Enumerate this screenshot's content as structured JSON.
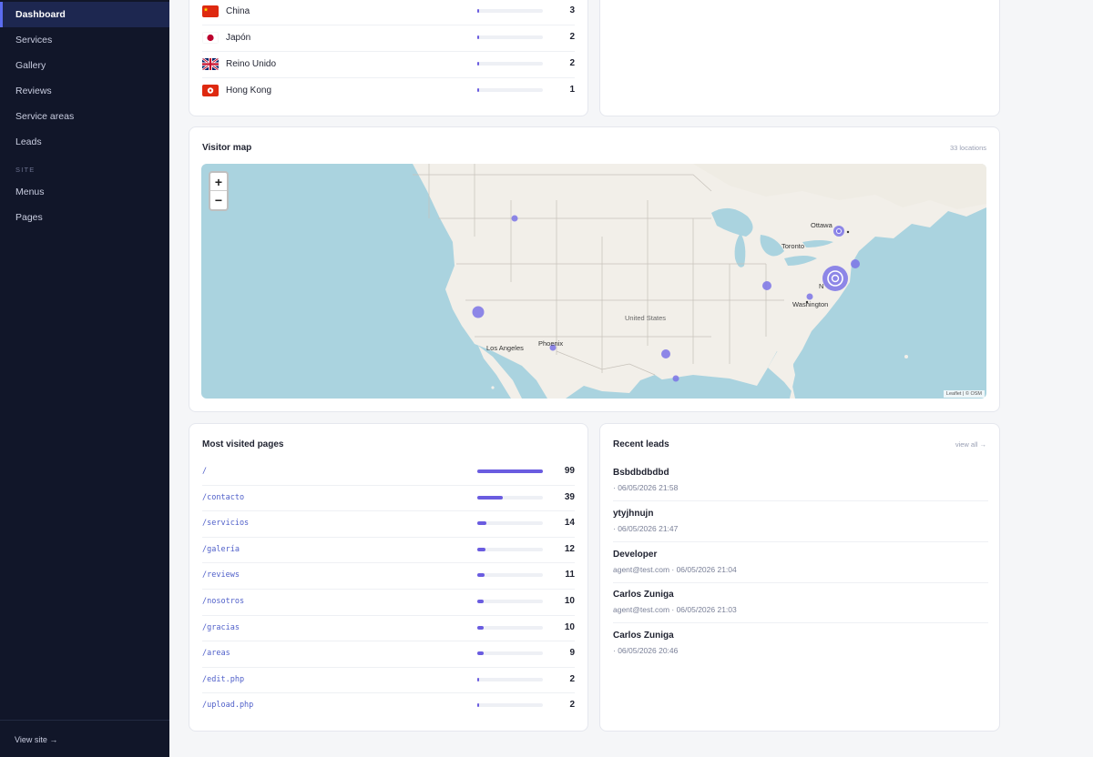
{
  "sidebar": {
    "items": [
      {
        "label": "Dashboard",
        "active": true
      },
      {
        "label": "Services"
      },
      {
        "label": "Gallery"
      },
      {
        "label": "Reviews"
      },
      {
        "label": "Service areas"
      },
      {
        "label": "Leads"
      }
    ],
    "section_site": "SITE",
    "site_items": [
      {
        "label": "Menus"
      },
      {
        "label": "Pages"
      }
    ],
    "view_site": "View site →"
  },
  "countries": {
    "rows": [
      {
        "name": "China",
        "count": "3",
        "fraction": 0.03
      },
      {
        "name": "Japón",
        "count": "2",
        "fraction": 0.02
      },
      {
        "name": "Reino Unido",
        "count": "2",
        "fraction": 0.02
      },
      {
        "name": "Hong Kong",
        "count": "1",
        "fraction": 0.01
      }
    ]
  },
  "visitor_map": {
    "title": "Visitor map",
    "meta": "33 locations",
    "zoom_in": "+",
    "zoom_out": "−",
    "labels": {
      "ottawa": "Ottawa",
      "toronto": "Toronto",
      "washington": "Washington",
      "new_york": "N",
      "united_states": "United States",
      "phoenix": "Phoenix",
      "los_angeles": "Los Angeles"
    },
    "attribution": "Leaflet | © OSM"
  },
  "pages": {
    "title": "Most visited pages",
    "rows": [
      {
        "path": "/",
        "count": "99",
        "fraction": 1.0
      },
      {
        "path": "/contacto",
        "count": "39",
        "fraction": 0.394
      },
      {
        "path": "/servicios",
        "count": "14",
        "fraction": 0.141
      },
      {
        "path": "/galería",
        "count": "12",
        "fraction": 0.121
      },
      {
        "path": "/reviews",
        "count": "11",
        "fraction": 0.111
      },
      {
        "path": "/nosotros",
        "count": "10",
        "fraction": 0.101
      },
      {
        "path": "/gracias",
        "count": "10",
        "fraction": 0.101
      },
      {
        "path": "/areas",
        "count": "9",
        "fraction": 0.091
      },
      {
        "path": "/edit.php",
        "count": "2",
        "fraction": 0.02
      },
      {
        "path": "/upload.php",
        "count": "2",
        "fraction": 0.02
      }
    ]
  },
  "leads": {
    "title": "Recent leads",
    "view_all": "view all →",
    "rows": [
      {
        "name": "Bsbdbdbdbd",
        "sub": "· 06/05/2026 21:58"
      },
      {
        "name": "ytyjhnujn",
        "sub": "· 06/05/2026 21:47"
      },
      {
        "name": "Developer",
        "sub": "agent@test.com · 06/05/2026 21:04"
      },
      {
        "name": "Carlos Zuniga",
        "sub": "agent@test.com · 06/05/2026 21:03"
      },
      {
        "name": "Carlos Zuniga",
        "sub": "· 06/05/2026 20:46"
      }
    ]
  },
  "colors": {
    "accent": "#6a5ce0",
    "sidebar_bg": "#111629",
    "map_water": "#aad3df",
    "map_land": "#f2efe9"
  }
}
